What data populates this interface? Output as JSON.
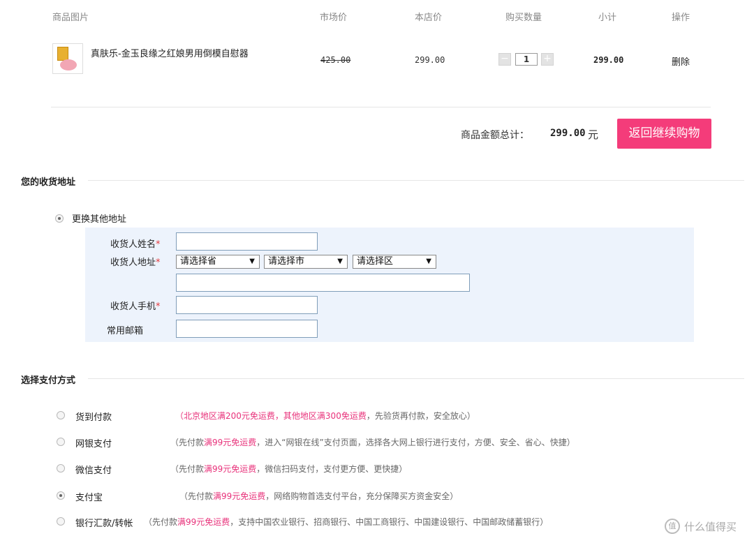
{
  "cart": {
    "headers": [
      "商品图片",
      "市场价",
      "本店价",
      "购买数量",
      "小计",
      "操作"
    ],
    "item": {
      "name": "真肤乐-金玉良缘之红娘男用倒模自慰器",
      "market_price": "425.00",
      "store_price": "299.00",
      "quantity": "1",
      "subtotal": "299.00",
      "action": "删除"
    },
    "minus_label": "−",
    "plus_label": "+",
    "total_label": "商品金额总计：",
    "total_value": "299.00",
    "total_unit": "元",
    "continue_label": "返回继续购物"
  },
  "address": {
    "section_title": "您的收货地址",
    "change_label": "更换其他地址",
    "name_label": "收货人姓名",
    "addr_label": "收货人地址",
    "phone_label": "收货人手机",
    "email_label": "常用邮箱",
    "required_mark": "*",
    "province_placeholder": "请选择省",
    "city_placeholder": "请选择市",
    "district_placeholder": "请选择区"
  },
  "payment": {
    "section_title": "选择支付方式",
    "options": [
      {
        "label": "货到付款",
        "prefix": "（",
        "highlight": "北京地区满200元免运费，其他地区满300免运费",
        "rest": "，先验货再付款，安全放心）",
        "checked": false
      },
      {
        "label": "网银支付",
        "prefix": "（先付款",
        "highlight": "满99元免运费",
        "rest": "，进入“网银在线”支付页面，选择各大网上银行进行支付，方便、安全、省心、快捷）",
        "checked": false
      },
      {
        "label": "微信支付",
        "prefix": "（先付款",
        "highlight": "满99元免运费",
        "rest": "，微信扫码支付，支付更方便、更快捷）",
        "checked": false
      },
      {
        "label": "支付宝",
        "prefix": "（先付款",
        "highlight": "满99元免运费",
        "rest": "，网络购物首选支付平台，充分保障买方资金安全）",
        "checked": true
      },
      {
        "label": "银行汇款/转帐",
        "prefix": "（先付款",
        "highlight": "满99元免运费",
        "rest": "，支持中国农业银行、招商银行、中国工商银行、中国建设银行、中国邮政储蓄银行）",
        "checked": false
      }
    ]
  },
  "watermark": {
    "icon": "值",
    "text": "什么值得买"
  }
}
